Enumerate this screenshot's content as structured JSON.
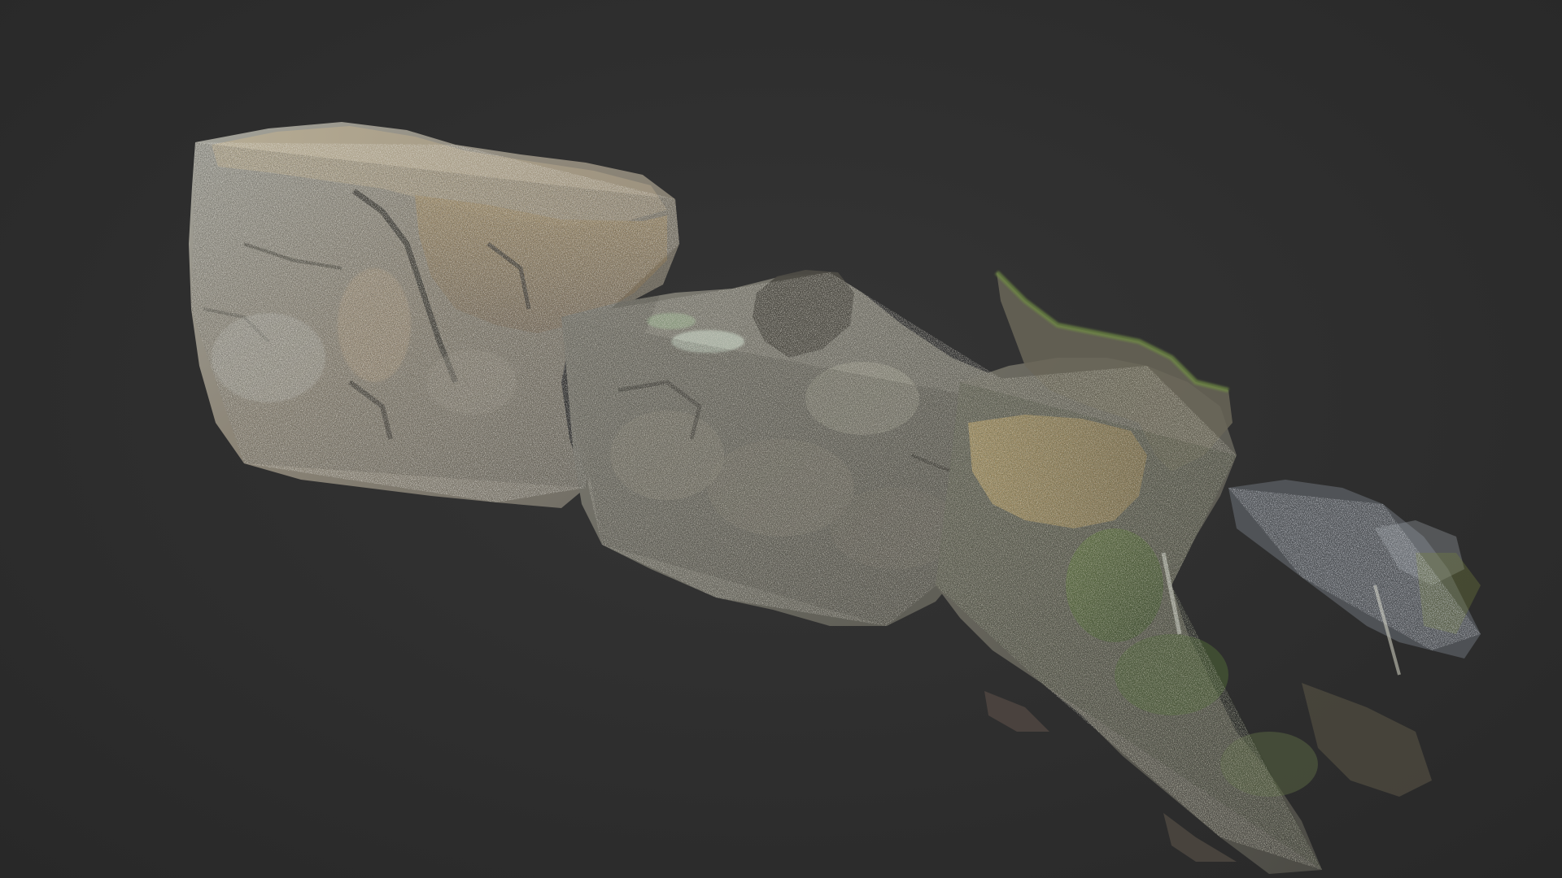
{
  "viewer": {
    "background_color": "#2e2e2e"
  },
  "scan": {
    "subject": "rock-outcrop-point-cloud",
    "palette": {
      "rock_light": "#b9ab8f",
      "rock_mid": "#8f8a7c",
      "rock_dark": "#4f4d47",
      "rock_grey": "#a7aaa6",
      "moss": "#5d7a3c",
      "sand": "#a88f62",
      "sparse_blue": "#8fa0b8"
    }
  }
}
